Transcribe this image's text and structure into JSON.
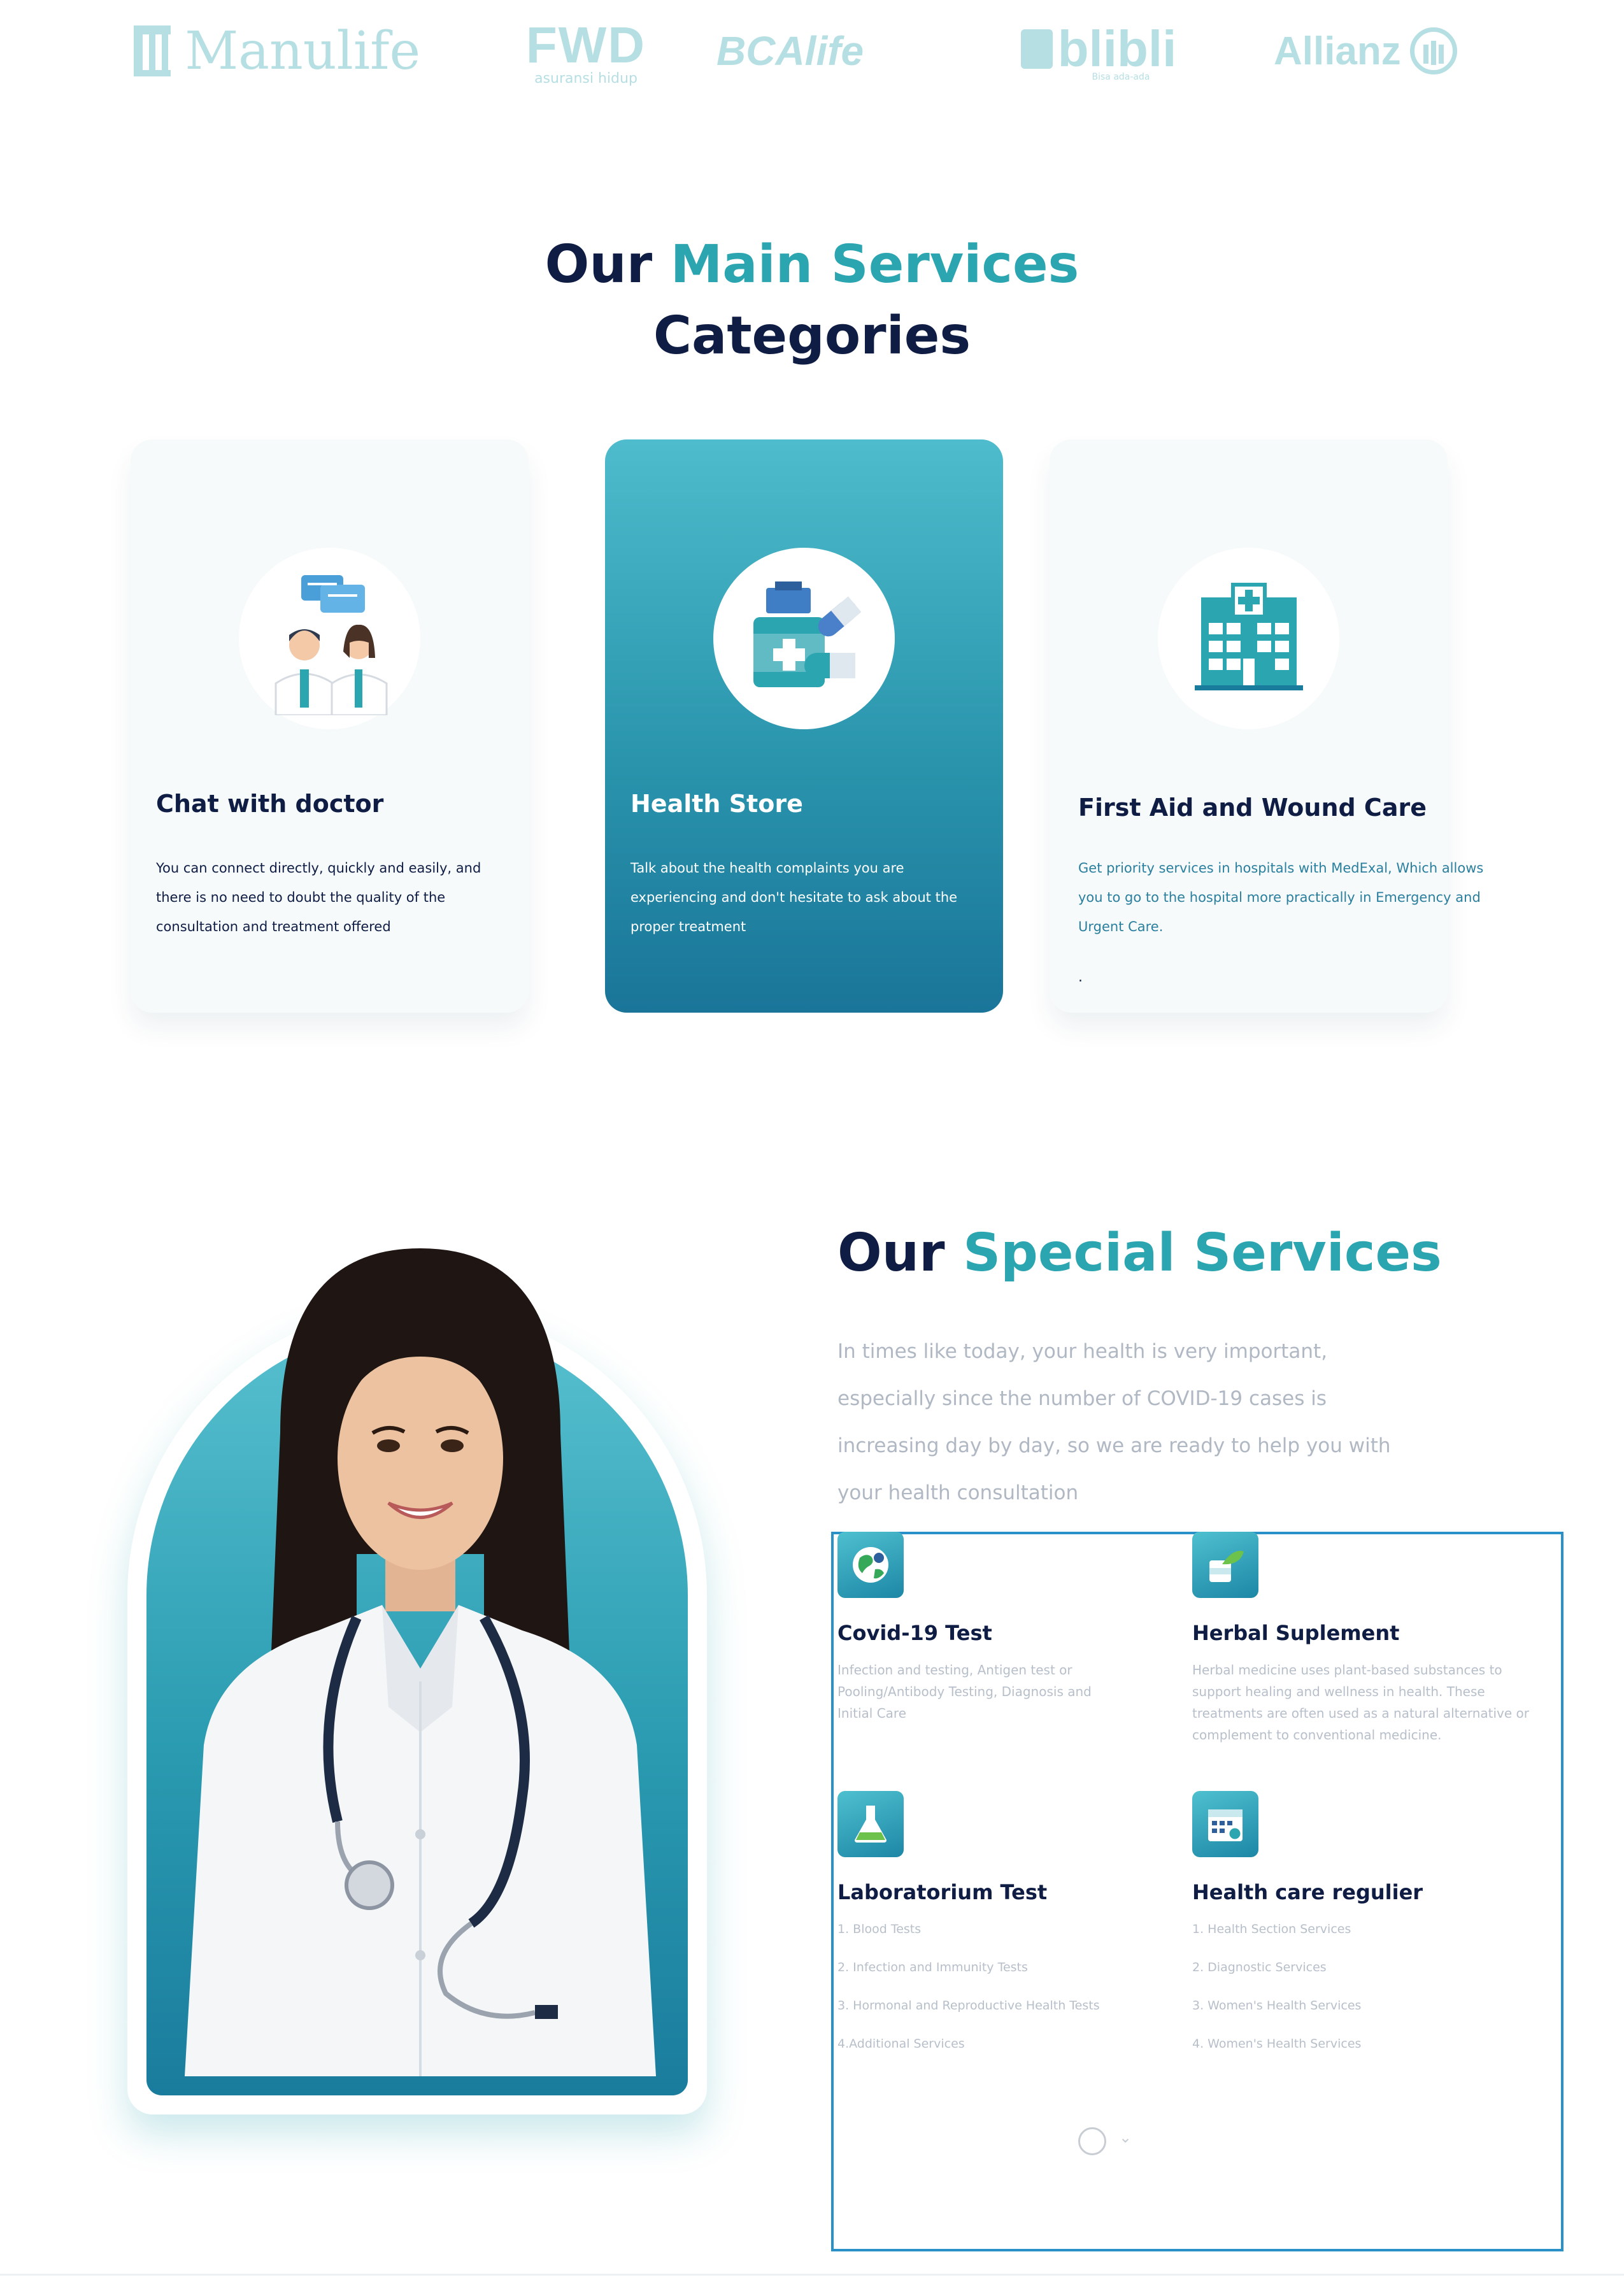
{
  "partners": {
    "manulife": "Manulife",
    "fwd": "FWD",
    "fwd_tagline": "asuransi hidup",
    "bca": "BCAlife",
    "blibli": "blibli",
    "blibli_tagline": "Bisa ada-ada",
    "allianz": "Allianz"
  },
  "main_services": {
    "heading_part1": "Our",
    "heading_accent": "Main Services",
    "heading_part2": "Categories",
    "cards": [
      {
        "title": "Chat with doctor",
        "text": "You can connect directly, quickly and easily, and there is no need to doubt the quality of the consultation and treatment offered",
        "icon": "doctor-chat-icon"
      },
      {
        "title": "Health Store",
        "text": "Talk about the health complaints you are experiencing and don't hesitate to ask about the proper treatment",
        "icon": "medicine-icon"
      },
      {
        "title": "First Aid and Wound Care",
        "text": "Get priority services in hospitals with MedExal, Which allows you to go to the hospital more practically in Emergency and Urgent Care.",
        "extra": ".",
        "icon": "hospital-icon"
      }
    ]
  },
  "special_services": {
    "heading_part1": "Our",
    "heading_accent": "Special Services",
    "text": "In times like today, your health is very important, especially since the number of COVID-19 cases is increasing day by day, so we are ready to help you with your health consultation",
    "items": [
      {
        "title": "Covid-19 Test",
        "text": "Infection and testing, Antigen test or Pooling/Antibody Testing, Diagnosis and Initial Care",
        "icon": "globe-virus-icon"
      },
      {
        "title": "Herbal Suplement",
        "text": "Herbal medicine uses plant-based substances to support healing and wellness in health. These treatments are often used as a natural alternative or complement to conventional medicine.",
        "icon": "herbal-bottle-icon"
      },
      {
        "title": "Laboratorium Test",
        "list": [
          "1. Blood Tests",
          "2. Infection and Immunity Tests",
          "3. Hormonal and Reproductive Health Tests",
          "4.Additional Services"
        ],
        "icon": "lab-flask-icon"
      },
      {
        "title": "Health care regulier",
        "list": [
          "1. Health Section Services",
          "2. Diagnostic Services",
          "3. Women's Health Services",
          "4. Women's Health Services"
        ],
        "icon": "calendar-icon"
      }
    ]
  },
  "colors": {
    "navy": "#0f1d45",
    "accent": "#2ba5b0",
    "card_gradient_top": "#4ebccc",
    "card_gradient_bottom": "#1a7599",
    "selection_border": "#2a90c8"
  }
}
